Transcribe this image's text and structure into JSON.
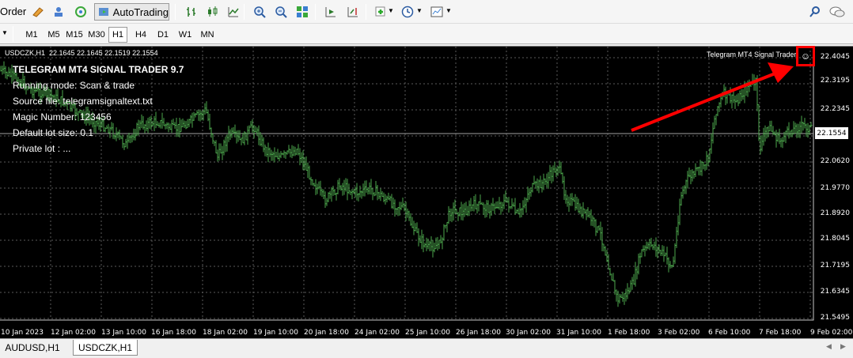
{
  "toolbar": {
    "order_label": "Order",
    "autotrading_label": "AutoTrading"
  },
  "timeframes": [
    "M1",
    "M5",
    "M15",
    "M30",
    "H1",
    "H4",
    "D1",
    "W1",
    "MN"
  ],
  "active_timeframe": "H1",
  "chart": {
    "header": "USDCZK,H1  22.1645 22.1645 22.1519 22.1554",
    "ea_label": "Telegram MT4 Signal Trader",
    "current_price": "22.1554",
    "info_lines": [
      "TELEGRAM MT4 SIGNAL TRADER 9.7",
      "Running mode: Scan & trade",
      "Source file: telegramsignaltext.txt",
      "Magic Number: 123456",
      "Default lot size: 0.1",
      "Private lot : ..."
    ],
    "price_axis": [
      "22.4045",
      "22.3195",
      "22.2345",
      "22.1554",
      "22.0620",
      "21.9770",
      "21.8920",
      "21.8045",
      "21.7195",
      "21.6345",
      "21.5495"
    ],
    "time_axis": [
      "10 Jan 2023",
      "12 Jan 02:00",
      "13 Jan 10:00",
      "16 Jan 18:00",
      "18 Jan 02:00",
      "19 Jan 10:00",
      "20 Jan 18:00",
      "24 Jan 02:00",
      "25 Jan 10:00",
      "26 Jan 18:00",
      "30 Jan 02:00",
      "31 Jan 10:00",
      "1 Feb 18:00",
      "3 Feb 02:00",
      "6 Feb 10:00",
      "7 Feb 18:00",
      "9 Feb 02:00"
    ],
    "colors": {
      "bars": "#4ca64c",
      "background": "#000000",
      "arrow": "#ff0000"
    }
  },
  "tabs": [
    "AUDUSD,H1",
    "USDCZK,H1"
  ],
  "active_tab": "USDCZK,H1"
}
